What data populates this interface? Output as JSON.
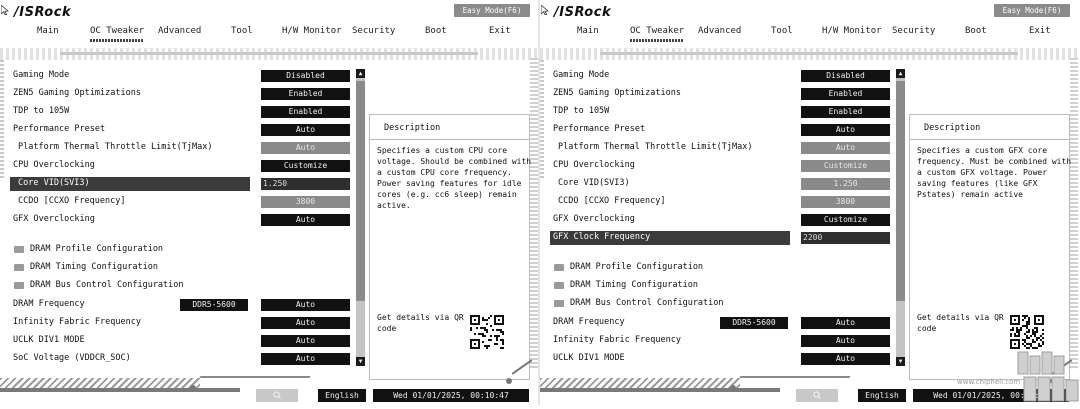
{
  "screens": [
    {
      "logo": "/ISRock",
      "easy_mode_label": "Easy Mode(F6)",
      "tabs": [
        {
          "label": "Main"
        },
        {
          "label": "OC Tweaker"
        },
        {
          "label": "Advanced"
        },
        {
          "label": "Tool"
        },
        {
          "label": "H/W Monitor"
        },
        {
          "label": "Security"
        },
        {
          "label": "Boot"
        },
        {
          "label": "Exit"
        }
      ],
      "active_tab": "OC Tweaker",
      "rows": [
        {
          "label": "Gaming Mode",
          "value": "Disabled"
        },
        {
          "label": "ZEN5 Gaming Optimizations",
          "value": "Enabled"
        },
        {
          "label": "TDP to 105W",
          "value": "Enabled"
        },
        {
          "label": "Performance Preset",
          "value": "Auto"
        },
        {
          "label": "Platform Thermal Throttle Limit(TjMax)",
          "value": "Auto"
        },
        {
          "label": "CPU Overclocking",
          "value": "Customize"
        },
        {
          "label": "Core VID(SVI3)",
          "value": "1.250"
        },
        {
          "label": "CCDO [CCXO Frequency]",
          "value": "3800"
        },
        {
          "label": "GFX Overclocking",
          "value": "Auto"
        },
        {
          "label": "DRAM Profile Configuration",
          "value": ""
        },
        {
          "label": "DRAM Timing Configuration",
          "value": ""
        },
        {
          "label": "DRAM Bus Control Configuration",
          "value": ""
        },
        {
          "label": "DRAM Frequency",
          "value": "Auto",
          "extra": "DDR5-5600"
        },
        {
          "label": "Infinity Fabric Frequency",
          "value": "Auto"
        },
        {
          "label": "UCLK DIV1 MODE",
          "value": "Auto"
        },
        {
          "label": "SoC Voltage (VDDCR_SOC)",
          "value": "Auto"
        }
      ],
      "description_title": "Description",
      "description_text": "Specifies a custom CPU core\nvoltage. Should be combined with\na custom CPU core frequency.\nPower saving features for idle\ncores (e.g. cc6 sleep) remain\nactive.",
      "qr_text": "Get details via QR\ncode",
      "language": "English",
      "datetime": "Wed 01/01/2025, 00:10:47"
    },
    {
      "logo": "/ISRock",
      "easy_mode_label": "Easy Mode(F6)",
      "tabs": [
        {
          "label": "Main"
        },
        {
          "label": "OC Tweaker"
        },
        {
          "label": "Advanced"
        },
        {
          "label": "Tool"
        },
        {
          "label": "H/W Monitor"
        },
        {
          "label": "Security"
        },
        {
          "label": "Boot"
        },
        {
          "label": "Exit"
        }
      ],
      "active_tab": "OC Tweaker",
      "rows": [
        {
          "label": "Gaming Mode",
          "value": "Disabled"
        },
        {
          "label": "ZEN5 Gaming Optimizations",
          "value": "Enabled"
        },
        {
          "label": "TDP to 105W",
          "value": "Enabled"
        },
        {
          "label": "Performance Preset",
          "value": "Auto"
        },
        {
          "label": "Platform Thermal Throttle Limit(TjMax)",
          "value": "Auto"
        },
        {
          "label": "CPU Overclocking",
          "value": "Customize"
        },
        {
          "label": "Core VID(SVI3)",
          "value": "1.250"
        },
        {
          "label": "CCDO [CCXO Frequency]",
          "value": "3800"
        },
        {
          "label": "GFX Overclocking",
          "value": "Customize"
        },
        {
          "label": "GFX Clock Frequency",
          "value": "2200"
        },
        {
          "label": "DRAM Profile Configuration",
          "value": ""
        },
        {
          "label": "DRAM Timing Configuration",
          "value": ""
        },
        {
          "label": "DRAM Bus Control Configuration",
          "value": ""
        },
        {
          "label": "DRAM Frequency",
          "value": "Auto",
          "extra": "DDR5-5600"
        },
        {
          "label": "Infinity Fabric Frequency",
          "value": "Auto"
        },
        {
          "label": "UCLK DIV1 MODE",
          "value": "Auto"
        }
      ],
      "description_title": "Description",
      "description_text": "Specifies a custom GFX core\nfrequency. Must be combined with\na custom GFX voltage. Power\nsaving features (like GFX\nPstates) remain active",
      "qr_text": "Get details via QR\ncode",
      "language": "English",
      "datetime": "Wed 01/01/2025, 00:10:51"
    }
  ],
  "watermark": {
    "text": "chip hell",
    "url": "www.chiphell.com"
  }
}
